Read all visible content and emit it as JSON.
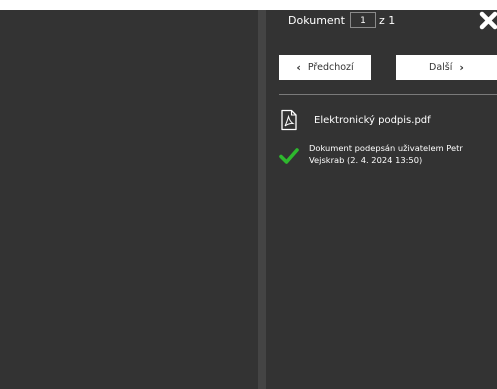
{
  "header": {
    "document_label": "Dokument",
    "page_number": "1",
    "page_total": "z 1"
  },
  "nav": {
    "prev_label": "Předchozí",
    "next_label": "Další"
  },
  "file": {
    "name": "Elektronický podpis.pdf",
    "icon": "pdf-file-icon"
  },
  "signature_status": {
    "text": "Dokument podepsán uživatelem Petr Vejskrab (2. 4. 2024 13:50)",
    "icon": "checkmark-icon",
    "color": "#2eb82e"
  },
  "colors": {
    "panel_background": "#333333",
    "button_background": "#ffffff"
  }
}
